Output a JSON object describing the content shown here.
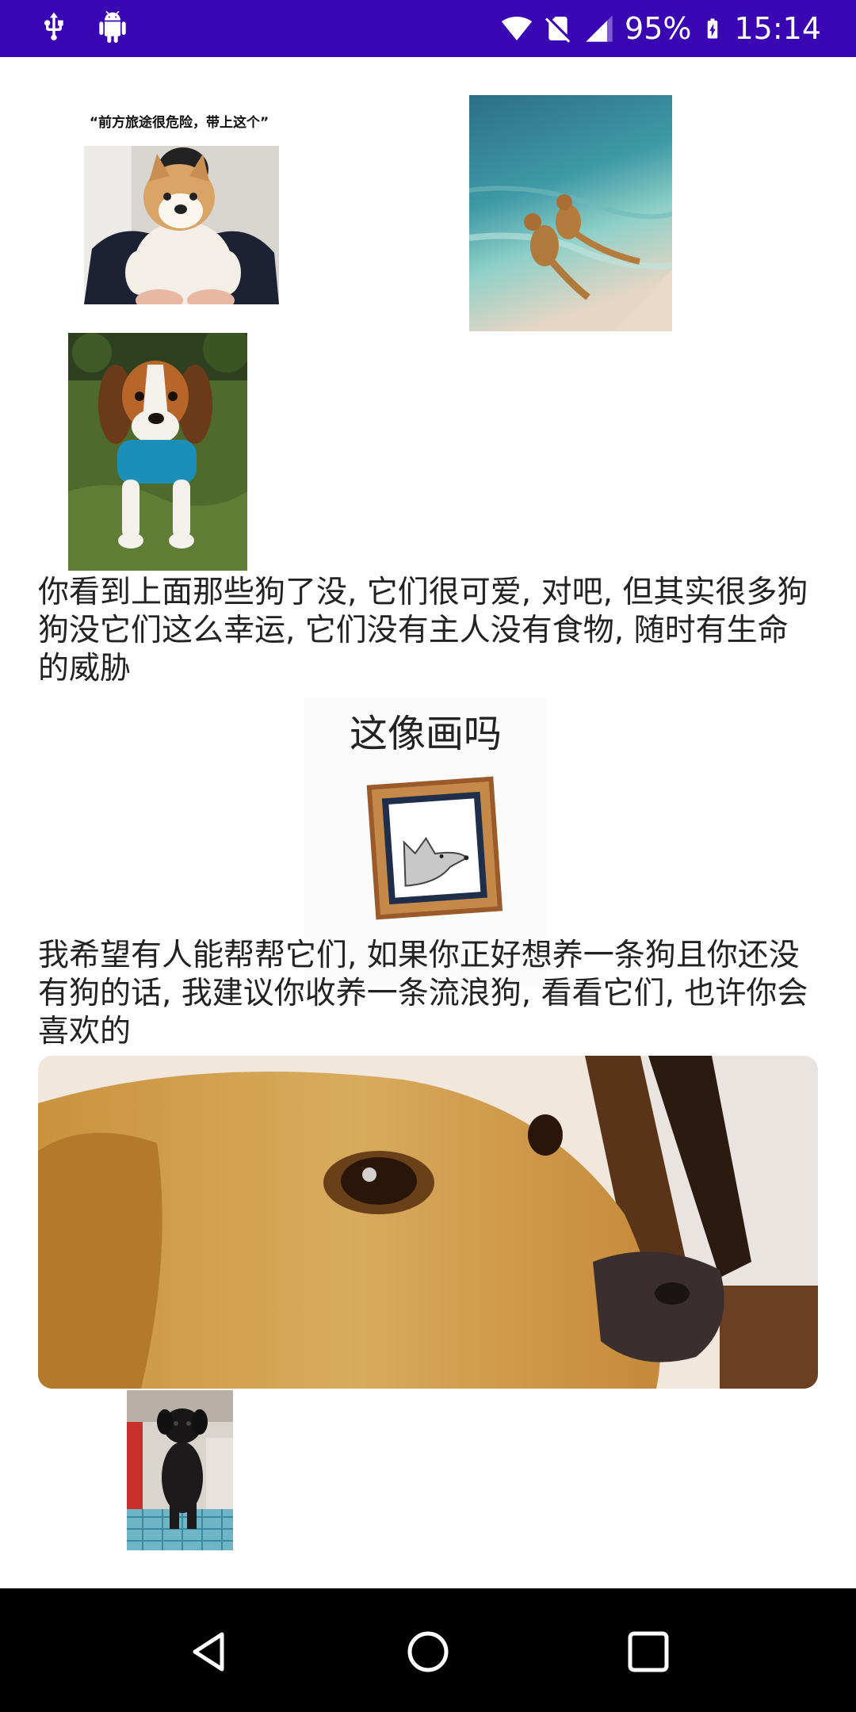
{
  "status_bar": {
    "battery_percent": "95%",
    "time": "15:14",
    "icons": [
      "usb-icon",
      "android-debug-icon",
      "wifi-icon",
      "no-sim-icon",
      "signal-icon",
      "battery-charging-icon"
    ]
  },
  "content": {
    "images": [
      {
        "name": "shiba-meme-image",
        "caption": "“前方旅途很危险，带上这个”"
      },
      {
        "name": "dogs-in-sea-image"
      },
      {
        "name": "beagle-puppy-image"
      },
      {
        "name": "framed-dog-meme-image",
        "caption": "这像画吗"
      },
      {
        "name": "golden-dog-closeup-image"
      },
      {
        "name": "black-puppy-image"
      }
    ],
    "paragraph_1": "你看到上面那些狗了没, 它们很可爱, 对吧, 但其实很多狗狗没它们这么幸运, 它们没有主人没有食物, 随时有生命的威胁",
    "paragraph_2": "我希望有人能帮帮它们, 如果你正好想养一条狗且你还没有狗的话, 我建议你收养一条流浪狗, 看看它们, 也许你会喜欢的"
  },
  "nav_bar": {
    "buttons": [
      "back-button",
      "home-button",
      "recents-button"
    ]
  },
  "colors": {
    "status_bar": "#3A06B3",
    "nav_bar": "#000000",
    "text": "#222222"
  }
}
